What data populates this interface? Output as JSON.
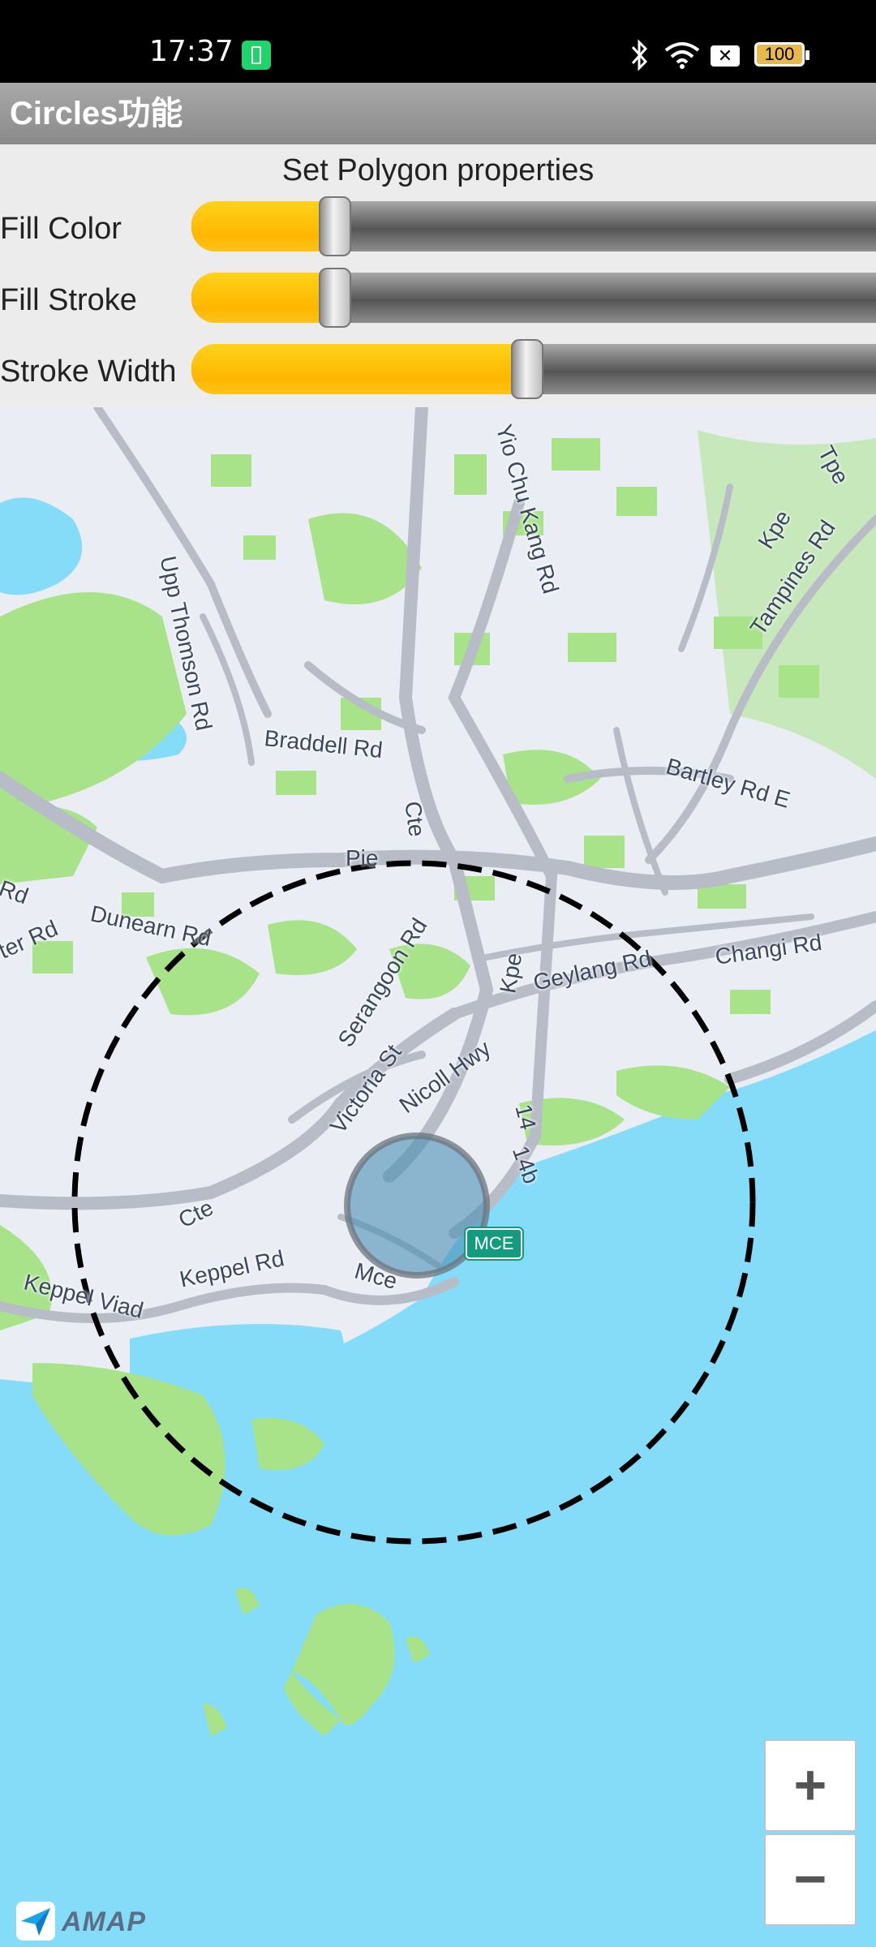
{
  "status_bar": {
    "time": "17:37",
    "battery_level": "100",
    "icons": [
      "charging-icon",
      "bluetooth-icon",
      "wifi-icon",
      "sim-x-icon",
      "battery-icon"
    ]
  },
  "app": {
    "title": "Circles功能"
  },
  "controls": {
    "heading": "Set Polygon properties",
    "sliders": [
      {
        "label": "Fill Color",
        "value": 0.21
      },
      {
        "label": "Fill Stroke",
        "value": 0.21
      },
      {
        "label": "Stroke Width",
        "value": 0.49
      }
    ]
  },
  "map": {
    "labels": {
      "yio_chu_kang": "Yio Chu Kang Rd",
      "tpe": "Tpe",
      "kpe_tampines": "Kpe",
      "tampines": "Tampines Rd",
      "upp_thomson": "Upp Thomson Rd",
      "braddell": "Braddell Rd",
      "bartley": "Bartley Rd E",
      "cte_top": "Cte",
      "pie": "Pie",
      "rd_left": "Rd",
      "dunearn": "Dunearn Rd",
      "ter_rd": "ter Rd",
      "serangoon": "Serangoon Rd",
      "kpe_mid": "Kpe",
      "geylang": "Geylang Rd",
      "changi": "Changi Rd",
      "victoria": "Victoria St",
      "nicoll": "Nicoll Hwy",
      "r14": "14",
      "r14b": "14b",
      "cte_bottom": "Cte",
      "keppel_rd": "Keppel Rd",
      "mce": "Mce",
      "keppel_viad": "Keppel Viad",
      "mce_badge": "MCE"
    },
    "zoom_in": "+",
    "zoom_out": "−",
    "logo_text": "AMAP",
    "colors": {
      "water": "#84dcf9",
      "park": "#a8e38a",
      "road": "#b7bcc6",
      "circle_stroke": "#000000",
      "inner_circle_fill": "#4b8fb4"
    }
  }
}
